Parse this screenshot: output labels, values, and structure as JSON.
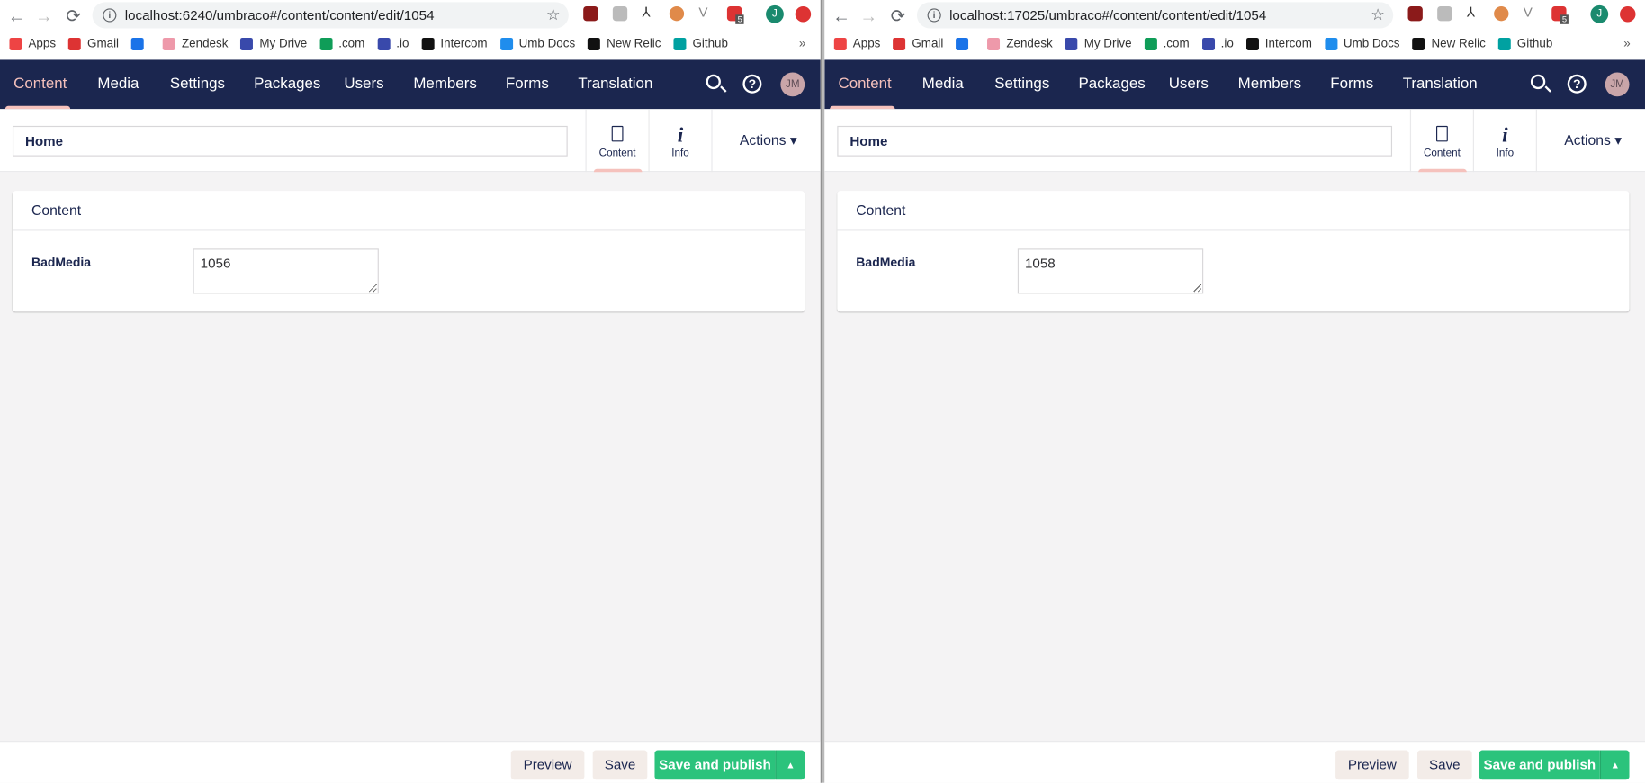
{
  "shared": {
    "bookmarks": [
      "Apps",
      "Gmail",
      "",
      "Zendesk",
      "My Drive",
      ".com",
      ".io",
      "Intercom",
      "Umb Docs",
      "New Relic",
      "Github"
    ],
    "bookmarks_more": "»",
    "extension_badge": "5",
    "profile_initial": "J",
    "nav": [
      "Content",
      "Media",
      "Settings",
      "Packages",
      "Users",
      "Members",
      "Forms",
      "Translation"
    ],
    "avatar_initials": "JM",
    "help_glyph": "?",
    "apps": {
      "content": "Content",
      "info": "Info"
    },
    "actions": "Actions ▾",
    "card_title": "Content",
    "property_label": "BadMedia",
    "buttons": {
      "preview": "Preview",
      "save": "Save",
      "save_publish": "Save and publish",
      "caret": "▲"
    },
    "colors": {
      "nav_bg": "#1b264f",
      "active": "#f5c1bc",
      "publish": "#2bc37c",
      "secondary_btn": "#f3ece8"
    }
  },
  "panes": [
    {
      "url": "localhost:6240/umbraco#/content/content/edit/1054",
      "node_name": "Home",
      "bad_media_value": "1056"
    },
    {
      "url": "localhost:17025/umbraco#/content/content/edit/1054",
      "node_name": "Home",
      "bad_media_value": "1058"
    }
  ]
}
